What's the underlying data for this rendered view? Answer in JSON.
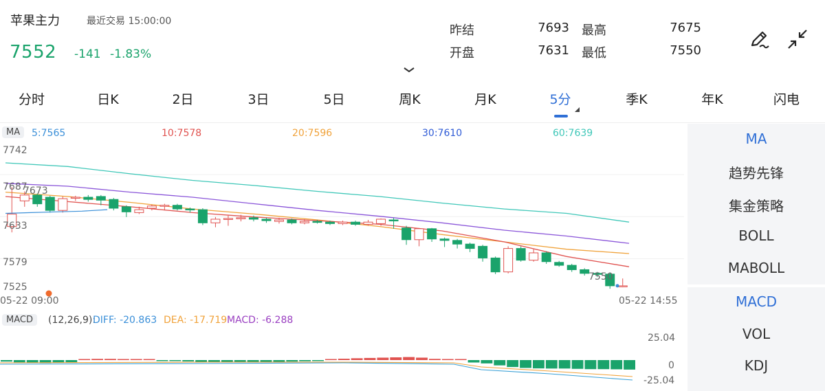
{
  "header": {
    "title": "苹果主力",
    "trade_label": "最近交易 15:00:00",
    "price": "7552",
    "change": "-141",
    "change_pct": "-1.83%",
    "stats": [
      {
        "label": "昨结",
        "value": "7693"
      },
      {
        "label": "最高",
        "value": "7675"
      },
      {
        "label": "开盘",
        "value": "7631"
      },
      {
        "label": "最低",
        "value": "7550"
      }
    ]
  },
  "tabs": [
    "分时",
    "日K",
    "2日",
    "3日",
    "5日",
    "周K",
    "月K",
    "5分",
    "季K",
    "年K",
    "闪电"
  ],
  "active_tab": "5分",
  "ma_legend": {
    "tag": "MA",
    "items": [
      {
        "text": "5:7565",
        "color": "#3a8fd8"
      },
      {
        "text": "10:7578",
        "color": "#e0524f"
      },
      {
        "text": "20:7596",
        "color": "#f0a23a"
      },
      {
        "text": "30:7610",
        "color": "#2f5bd6"
      },
      {
        "text": "60:7639",
        "color": "#3fc7b8"
      }
    ]
  },
  "price_axis": [
    "7742",
    "7687",
    "7673",
    "7633",
    "7579",
    "7525"
  ],
  "last_price_label": "7550",
  "time_start": "05-22 09:00",
  "time_end": "05-22 14:55",
  "side_panel": {
    "top": [
      "MA",
      "趋势先锋",
      "集金策略",
      "BOLL",
      "MABOLL"
    ],
    "bottom": [
      "MACD",
      "VOL",
      "KDJ"
    ]
  },
  "macd": {
    "tag": "MACD",
    "params": "(12,26,9):",
    "diff": "DIFF: -20.863",
    "dea": "DEA: -17.719",
    "macd": "MACD: -6.288",
    "axis": [
      "25.04",
      "0",
      "-25.04"
    ]
  },
  "colors": {
    "up": "#e0524f",
    "down": "#1aa36b",
    "accent": "#2f6fd6",
    "ma5": "#3a8fd8",
    "ma10": "#e0524f",
    "ma20": "#f0a23a",
    "ma30": "#8a55d9",
    "ma60": "#3fc7b8"
  },
  "chart_data": {
    "type": "candlestick",
    "y_range": [
      7520,
      7750
    ],
    "candles": [
      {
        "o": 7633,
        "c": 7650,
        "h": 7687,
        "l": 7625
      },
      {
        "o": 7668,
        "c": 7676,
        "h": 7681,
        "l": 7660
      },
      {
        "o": 7676,
        "c": 7664,
        "h": 7678,
        "l": 7660
      },
      {
        "o": 7673,
        "c": 7655,
        "h": 7675,
        "l": 7652
      },
      {
        "o": 7655,
        "c": 7671,
        "h": 7674,
        "l": 7652
      },
      {
        "o": 7672,
        "c": 7673,
        "h": 7675,
        "l": 7668
      },
      {
        "o": 7673,
        "c": 7670,
        "h": 7676,
        "l": 7667
      },
      {
        "o": 7674,
        "c": 7669,
        "h": 7676,
        "l": 7662
      },
      {
        "o": 7670,
        "c": 7658,
        "h": 7672,
        "l": 7655
      },
      {
        "o": 7660,
        "c": 7653,
        "h": 7662,
        "l": 7646
      },
      {
        "o": 7652,
        "c": 7656,
        "h": 7660,
        "l": 7650
      },
      {
        "o": 7658,
        "c": 7661,
        "h": 7663,
        "l": 7655
      },
      {
        "o": 7661,
        "c": 7662,
        "h": 7664,
        "l": 7655
      },
      {
        "o": 7662,
        "c": 7657,
        "h": 7664,
        "l": 7655
      },
      {
        "o": 7657,
        "c": 7656,
        "h": 7659,
        "l": 7652
      },
      {
        "o": 7656,
        "c": 7638,
        "h": 7658,
        "l": 7635
      },
      {
        "o": 7638,
        "c": 7643,
        "h": 7646,
        "l": 7632
      },
      {
        "o": 7643,
        "c": 7644,
        "h": 7648,
        "l": 7634
      },
      {
        "o": 7644,
        "c": 7645,
        "h": 7649,
        "l": 7640
      },
      {
        "o": 7645,
        "c": 7643,
        "h": 7648,
        "l": 7640
      },
      {
        "o": 7643,
        "c": 7641,
        "h": 7645,
        "l": 7638
      },
      {
        "o": 7640,
        "c": 7642,
        "h": 7645,
        "l": 7637
      },
      {
        "o": 7642,
        "c": 7638,
        "h": 7644,
        "l": 7636
      },
      {
        "o": 7638,
        "c": 7640,
        "h": 7643,
        "l": 7636
      },
      {
        "o": 7640,
        "c": 7639,
        "h": 7642,
        "l": 7637
      },
      {
        "o": 7639,
        "c": 7637,
        "h": 7641,
        "l": 7635
      },
      {
        "o": 7637,
        "c": 7639,
        "h": 7641,
        "l": 7635
      },
      {
        "o": 7639,
        "c": 7636,
        "h": 7641,
        "l": 7634
      },
      {
        "o": 7636,
        "c": 7639,
        "h": 7642,
        "l": 7634
      },
      {
        "o": 7637,
        "c": 7643,
        "h": 7644,
        "l": 7634
      },
      {
        "o": 7642,
        "c": 7641,
        "h": 7645,
        "l": 7630
      },
      {
        "o": 7631,
        "c": 7615,
        "h": 7634,
        "l": 7608
      },
      {
        "o": 7615,
        "c": 7630,
        "h": 7631,
        "l": 7606
      },
      {
        "o": 7630,
        "c": 7616,
        "h": 7631,
        "l": 7612
      },
      {
        "o": 7616,
        "c": 7614,
        "h": 7618,
        "l": 7605
      },
      {
        "o": 7614,
        "c": 7609,
        "h": 7616,
        "l": 7603
      },
      {
        "o": 7609,
        "c": 7603,
        "h": 7611,
        "l": 7598
      },
      {
        "o": 7606,
        "c": 7590,
        "h": 7608,
        "l": 7585
      },
      {
        "o": 7590,
        "c": 7571,
        "h": 7592,
        "l": 7568
      },
      {
        "o": 7571,
        "c": 7603,
        "h": 7606,
        "l": 7569
      },
      {
        "o": 7603,
        "c": 7587,
        "h": 7606,
        "l": 7585
      },
      {
        "o": 7587,
        "c": 7597,
        "h": 7602,
        "l": 7585
      },
      {
        "o": 7597,
        "c": 7585,
        "h": 7599,
        "l": 7582
      },
      {
        "o": 7584,
        "c": 7580,
        "h": 7586,
        "l": 7578
      },
      {
        "o": 7580,
        "c": 7574,
        "h": 7582,
        "l": 7571
      },
      {
        "o": 7574,
        "c": 7569,
        "h": 7576,
        "l": 7566
      },
      {
        "o": 7569,
        "c": 7568,
        "h": 7571,
        "l": 7564
      },
      {
        "o": 7568,
        "c": 7552,
        "h": 7570,
        "l": 7548
      },
      {
        "o": 7552,
        "c": 7552,
        "h": 7562,
        "l": 7550
      }
    ],
    "ma": {
      "ma5": [
        7651,
        7652,
        7653,
        7654,
        7656
      ],
      "ma60": [
        7720,
        7715,
        7705,
        7696,
        7689,
        7681,
        7674,
        7665,
        7657,
        7651,
        7639
      ],
      "ma30": [
        7692,
        7688,
        7680,
        7673,
        7664,
        7655,
        7647,
        7638,
        7628,
        7620,
        7610
      ],
      "ma20": [
        7680,
        7674,
        7666,
        7657,
        7650,
        7642,
        7633,
        7622,
        7612,
        7602,
        7596
      ],
      "ma10": [
        7674,
        7667,
        7660,
        7652,
        7646,
        7641,
        7636,
        7627,
        7612,
        7592,
        7578
      ]
    },
    "macd_hist": [
      -1,
      -1.5,
      -1.8,
      -2,
      -1.8,
      -1.5,
      0.5,
      0.8,
      0.8,
      0.6,
      0.5,
      0.4,
      -0.4,
      -0.6,
      -0.9,
      -1.2,
      -1.4,
      -1.5,
      -1.6,
      -1.6,
      -1.4,
      -1.2,
      -1.0,
      -0.8,
      -0.6,
      0.6,
      0.9,
      1.2,
      1.4,
      1.6,
      1.8,
      2.0,
      1.6,
      0.8,
      0.4,
      0.3,
      -1.6,
      -2.2,
      -3.5,
      -4.6,
      -5.2,
      -5.5,
      -5.6,
      -5.6,
      -5.8,
      -6.0,
      -6.0,
      -6.1,
      -6.288
    ]
  }
}
